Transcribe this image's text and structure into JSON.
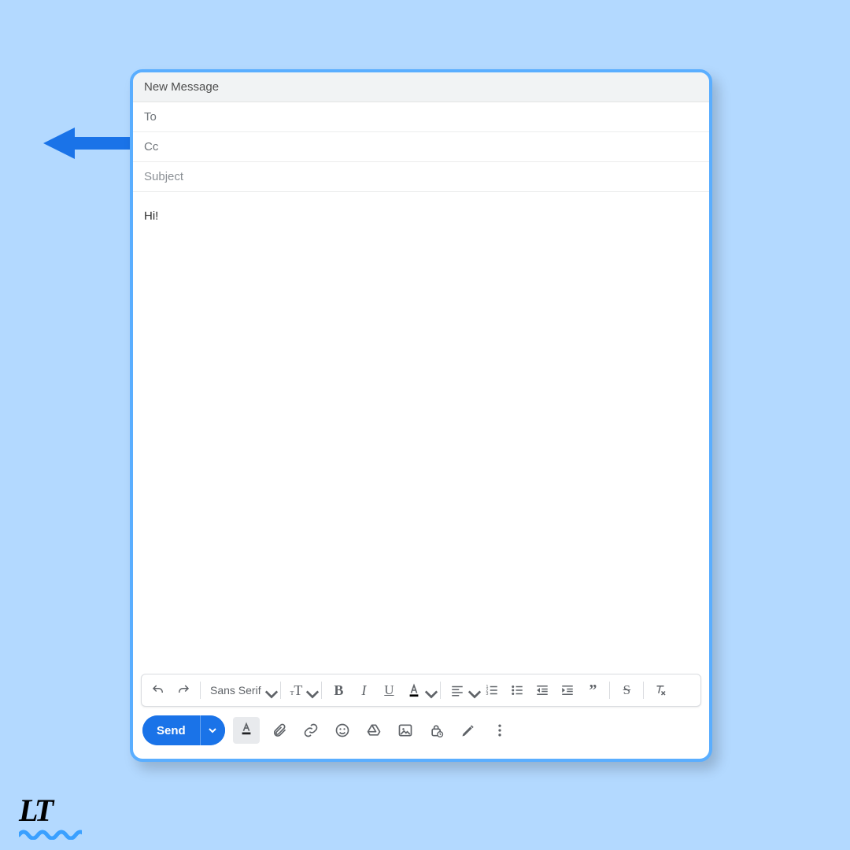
{
  "header": {
    "title": "New Message"
  },
  "fields": {
    "to_label": "To",
    "cc_label": "Cc",
    "subject_placeholder": "Subject"
  },
  "body": {
    "content": "Hi!"
  },
  "format_toolbar": {
    "font_family_label": "Sans Serif"
  },
  "actions": {
    "send_label": "Send"
  },
  "logo": {
    "text": "LT"
  }
}
